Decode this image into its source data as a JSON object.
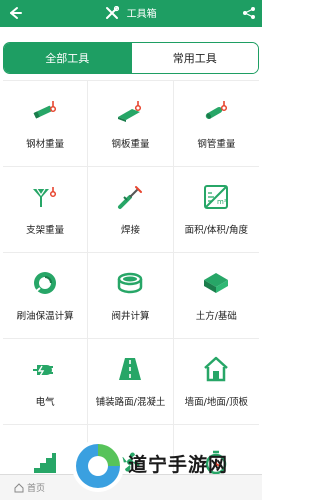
{
  "header": {
    "title": "工具箱",
    "back_icon": "back-arrow-icon",
    "share_icon": "share-icon",
    "title_icon": "tools-icon"
  },
  "tabs": [
    {
      "label": "全部工具",
      "active": true
    },
    {
      "label": "常用工具",
      "active": false
    }
  ],
  "tools": [
    {
      "label": "钢材重量",
      "icon": "steel-bar-icon"
    },
    {
      "label": "钢板重量",
      "icon": "steel-plate-icon"
    },
    {
      "label": "钢管重量",
      "icon": "steel-pipe-icon"
    },
    {
      "label": "支架重量",
      "icon": "bracket-icon"
    },
    {
      "label": "焊接",
      "icon": "welding-icon"
    },
    {
      "label": "面积/体积/角度",
      "icon": "measure-icon"
    },
    {
      "label": "刷油保温计算",
      "icon": "paint-insulation-icon"
    },
    {
      "label": "阀井计算",
      "icon": "valve-well-icon"
    },
    {
      "label": "土方/基础",
      "icon": "earthwork-icon"
    },
    {
      "label": "电气",
      "icon": "electric-plug-icon"
    },
    {
      "label": "铺装路面/混凝土",
      "icon": "road-icon"
    },
    {
      "label": "墙面/地面/顶板",
      "icon": "house-icon"
    },
    {
      "label": "",
      "icon": "stairs-icon"
    },
    {
      "label": "",
      "icon": "fan-icon"
    },
    {
      "label": "",
      "icon": "timer-icon"
    }
  ],
  "bottom": {
    "home_label": "首页"
  },
  "watermark": {
    "text": "道宁手游网"
  },
  "colors": {
    "primary": "#1e9e63",
    "icon_green": "#27a667",
    "accent_red": "#e8452f"
  }
}
